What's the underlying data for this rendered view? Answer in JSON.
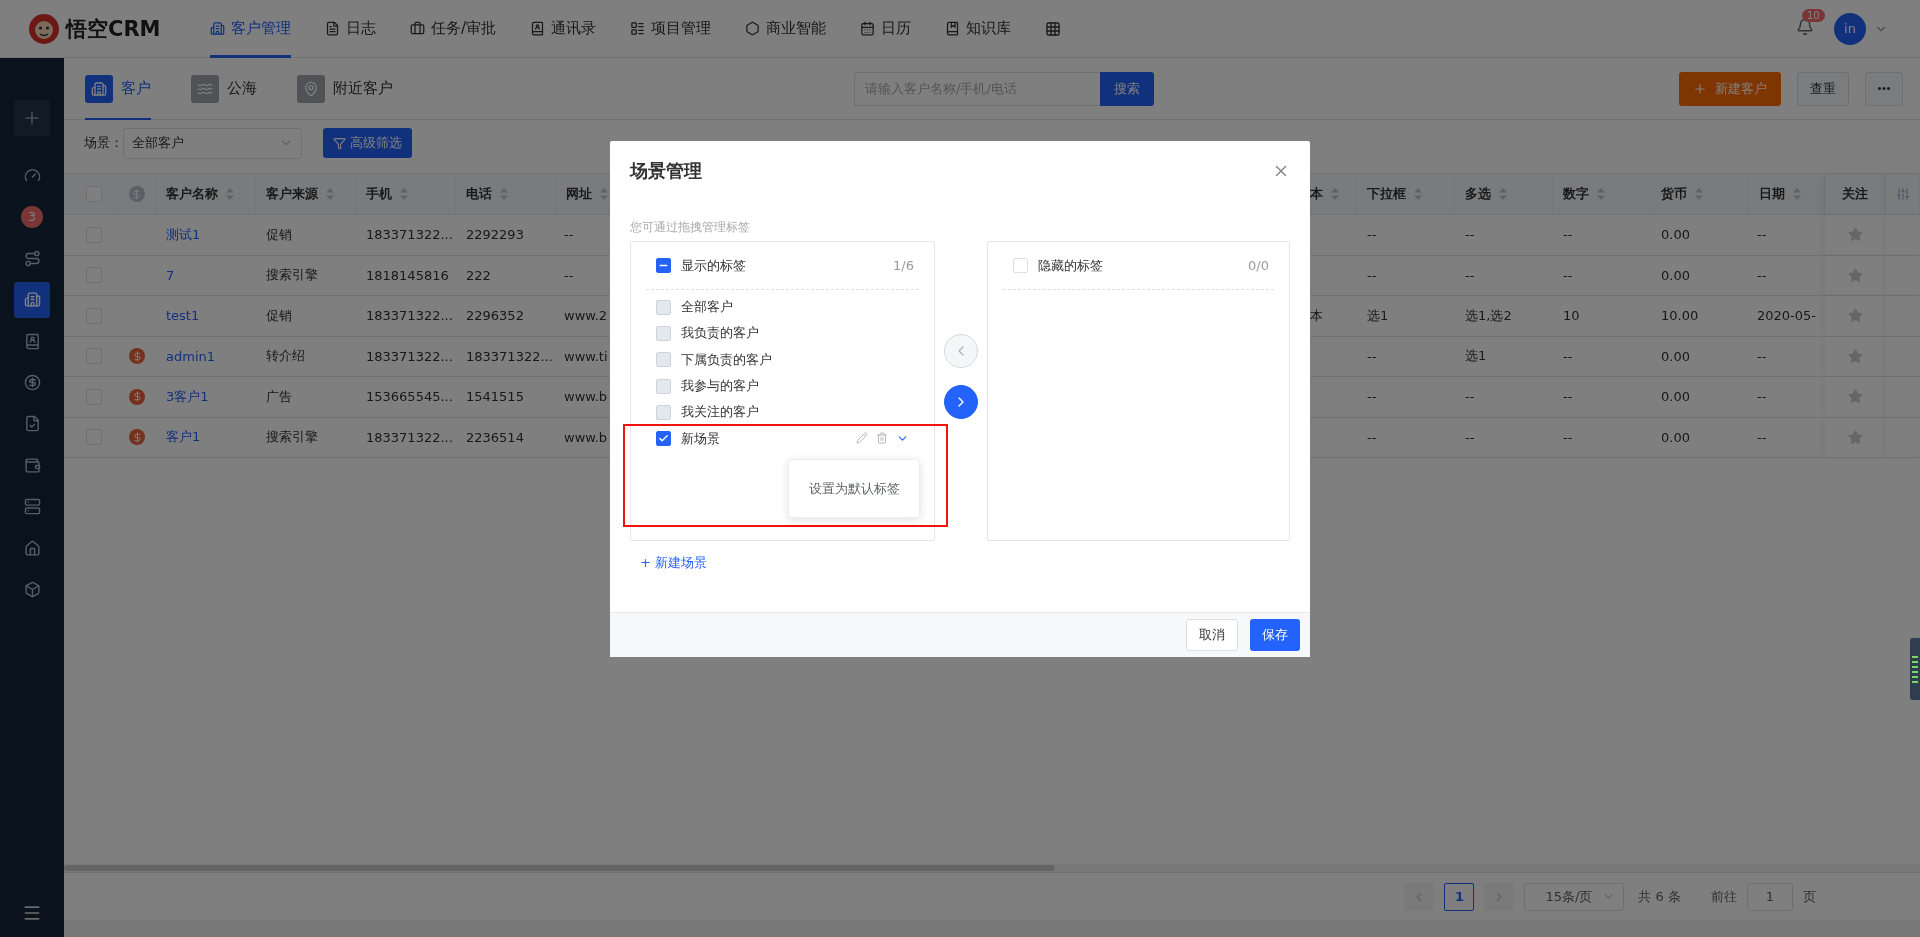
{
  "top_nav": {
    "logo": "悟空CRM",
    "items": [
      {
        "label": "客户管理",
        "selected": true
      },
      {
        "label": "日志",
        "selected": false
      },
      {
        "label": "任务/审批",
        "selected": false
      },
      {
        "label": "通讯录",
        "selected": false
      },
      {
        "label": "项目管理",
        "selected": false
      },
      {
        "label": "商业智能",
        "selected": false
      },
      {
        "label": "日历",
        "selected": false
      },
      {
        "label": "知识库",
        "selected": false
      }
    ],
    "notification_count": "10",
    "avatar": "in"
  },
  "sidebar": {
    "items": [
      {
        "selected": false
      },
      {
        "selected": false,
        "badge": "3"
      },
      {
        "selected": false
      },
      {
        "selected": true
      },
      {
        "selected": false
      },
      {
        "selected": false
      },
      {
        "selected": false
      },
      {
        "selected": false
      },
      {
        "selected": false
      },
      {
        "selected": false
      },
      {
        "selected": false
      }
    ]
  },
  "sub_tabs": [
    {
      "label": "客户",
      "selected": true
    },
    {
      "label": "公海",
      "selected": false
    },
    {
      "label": "附近客户",
      "selected": false
    }
  ],
  "search": {
    "placeholder": "请输入客户名称/手机/电话",
    "button": "搜索"
  },
  "actions": {
    "create": "新建客户",
    "dedupe": "查重"
  },
  "filter": {
    "label": "场景：",
    "scene": "全部客户",
    "advanced": "高级筛选"
  },
  "table": {
    "header_checked": false,
    "columns": [
      {
        "label": "客户名称"
      },
      {
        "label": "客户来源"
      },
      {
        "label": "手机"
      },
      {
        "label": "电话"
      },
      {
        "label": "网址"
      },
      {
        "label": "本"
      },
      {
        "label": "下拉框"
      },
      {
        "label": "多选"
      },
      {
        "label": "数字"
      },
      {
        "label": "货币"
      },
      {
        "label": "日期"
      }
    ],
    "follow_column": "关注",
    "rows": [
      {
        "checked": false,
        "deal": false,
        "followed": false,
        "cells": [
          "测试1",
          "促销",
          "183371322...",
          "2292293",
          "--",
          null,
          "--",
          "--",
          "--",
          "0.00",
          "--"
        ]
      },
      {
        "checked": false,
        "deal": false,
        "followed": false,
        "cells": [
          "7",
          "搜索引擎",
          "1818145816",
          "222",
          "--",
          null,
          "--",
          "--",
          "--",
          "0.00",
          "--"
        ]
      },
      {
        "checked": false,
        "deal": false,
        "followed": false,
        "cells": [
          "test1",
          "促销",
          "183371322...",
          "2296352",
          "www.2",
          "本",
          "选1",
          "选1,选2",
          "10",
          "10.00",
          "2020-05-"
        ]
      },
      {
        "checked": false,
        "deal": true,
        "followed": false,
        "cells": [
          "admin1",
          "转介绍",
          "183371322...",
          "183371322...",
          "www.ti",
          null,
          "--",
          "选1",
          "--",
          "0.00",
          "--"
        ]
      },
      {
        "checked": false,
        "deal": true,
        "followed": false,
        "cells": [
          "3客户1",
          "广告",
          "153665545...",
          "1541515",
          "www.b",
          null,
          "--",
          "--",
          "--",
          "0.00",
          "--"
        ]
      },
      {
        "checked": false,
        "deal": true,
        "followed": false,
        "cells": [
          "客户1",
          "搜索引擎",
          "183371322...",
          "2236514",
          "www.b",
          null,
          "--",
          "--",
          "--",
          "0.00",
          "--"
        ]
      }
    ]
  },
  "pagination": {
    "pages": [
      {
        "label": "1",
        "selected": true
      }
    ],
    "page_size": "15条/页",
    "total": "共 6 条",
    "goto_label": "前往",
    "goto_value": "1",
    "page_unit": "页"
  },
  "modal": {
    "title": "场景管理",
    "hint": "您可通过拖拽管理标签",
    "shown": {
      "title": "显示的标签",
      "count": "1/6",
      "indeterminate": true,
      "items": [
        {
          "label": "全部客户",
          "checked": false,
          "disabled": true
        },
        {
          "label": "我负责的客户",
          "checked": false,
          "disabled": true
        },
        {
          "label": "下属负责的客户",
          "checked": false,
          "disabled": true
        },
        {
          "label": "我参与的客户",
          "checked": false,
          "disabled": true
        },
        {
          "label": "我关注的客户",
          "checked": false,
          "disabled": true
        },
        {
          "label": "新场景",
          "checked": true,
          "menu_open": true
        }
      ]
    },
    "hidden": {
      "title": "隐藏的标签",
      "count": "0/0",
      "checked": false,
      "indeterminate": false
    },
    "move_left_enabled": false,
    "move_right_enabled": true,
    "menu_item": "设置为默认标签",
    "add_scene": "+ 新建场景",
    "cancel": "取消",
    "save": "保存"
  }
}
